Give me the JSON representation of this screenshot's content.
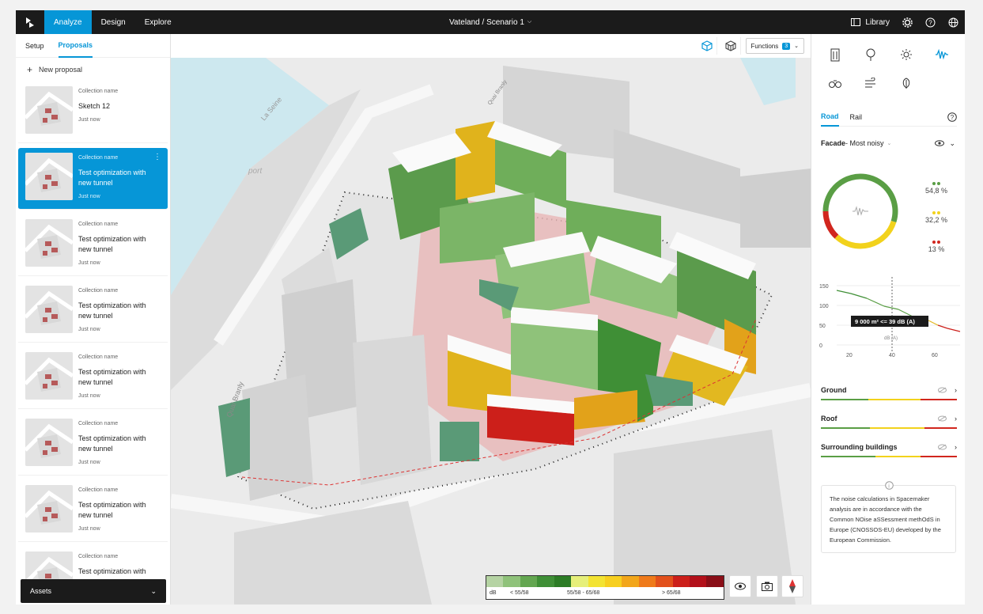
{
  "topbar": {
    "tabs": [
      {
        "label": "Analyze",
        "active": true
      },
      {
        "label": "Design",
        "active": false
      },
      {
        "label": "Explore",
        "active": false
      }
    ],
    "scenario": "Vateland / Scenario 1",
    "library_label": "Library",
    "accent": "#0696d7"
  },
  "left": {
    "tabs": [
      {
        "label": "Setup"
      },
      {
        "label": "Proposals"
      }
    ],
    "new_proposal": "New proposal",
    "cards": [
      {
        "collection": "Collection name",
        "name": "Sketch 12",
        "time": "Just now"
      },
      {
        "collection": "Collection name",
        "name": "Test optimization with new tunnel",
        "time": "Just now"
      },
      {
        "collection": "Collection name",
        "name": "Test optimization with new tunnel",
        "time": "Just now"
      },
      {
        "collection": "Collection name",
        "name": "Test optimization with new tunnel",
        "time": "Just now"
      },
      {
        "collection": "Collection name",
        "name": "Test optimization with new tunnel",
        "time": "Just now"
      },
      {
        "collection": "Collection name",
        "name": "Test optimization with new tunnel",
        "time": "Just now"
      },
      {
        "collection": "Collection name",
        "name": "Test optimization with new tunnel",
        "time": "Just now"
      },
      {
        "collection": "Collection name",
        "name": "Test optimization with",
        "time": ""
      }
    ],
    "assets": "Assets"
  },
  "maptools": {
    "functions_label": "Functions",
    "functions_count": "3"
  },
  "map": {
    "labels": {
      "river": "La Seine",
      "port": "port",
      "quai": "Quai Branly",
      "quai2": "Quai Branly"
    }
  },
  "legend": {
    "colors": [
      "#b5d3a3",
      "#8fc27a",
      "#63a650",
      "#3f8f36",
      "#2c7c25",
      "#e6ef7a",
      "#f3e332",
      "#f7cf1f",
      "#f2a61a",
      "#ef7a1a",
      "#e2501b",
      "#cc1f1a",
      "#b3101a",
      "#8a0e17"
    ],
    "labels": [
      "dB",
      "< 55/58",
      "55/58 - 65/68",
      "> 65/68"
    ]
  },
  "right": {
    "tabs": [
      {
        "label": "Road"
      },
      {
        "label": "Rail"
      }
    ],
    "facade_title": "Facade",
    "facade_sub": " - Most noisy",
    "pie": [
      {
        "label": "54,8 %",
        "value": 54.8,
        "color": "#5a9e45"
      },
      {
        "label": "32,2 %",
        "value": 32.2,
        "color": "#f2d21c"
      },
      {
        "label": "13 %",
        "value": 13,
        "color": "#d1261e"
      }
    ],
    "graph": {
      "yticks": [
        "150",
        "100",
        "50",
        "0"
      ],
      "xticks": [
        "20",
        "40",
        "60"
      ],
      "tooltip": "9 000 m² <= 39 dB (A)",
      "xunit": "dB (A)"
    },
    "sections": [
      {
        "label": "Ground"
      },
      {
        "label": "Roof"
      },
      {
        "label": "Surrounding buildings"
      }
    ],
    "info_text": "The noise calculations in Spacemaker analysis are in accordance with the Common NOise aSSessment methOdS in Europe (CNOSSOS-EU) developed by the European Commission."
  }
}
